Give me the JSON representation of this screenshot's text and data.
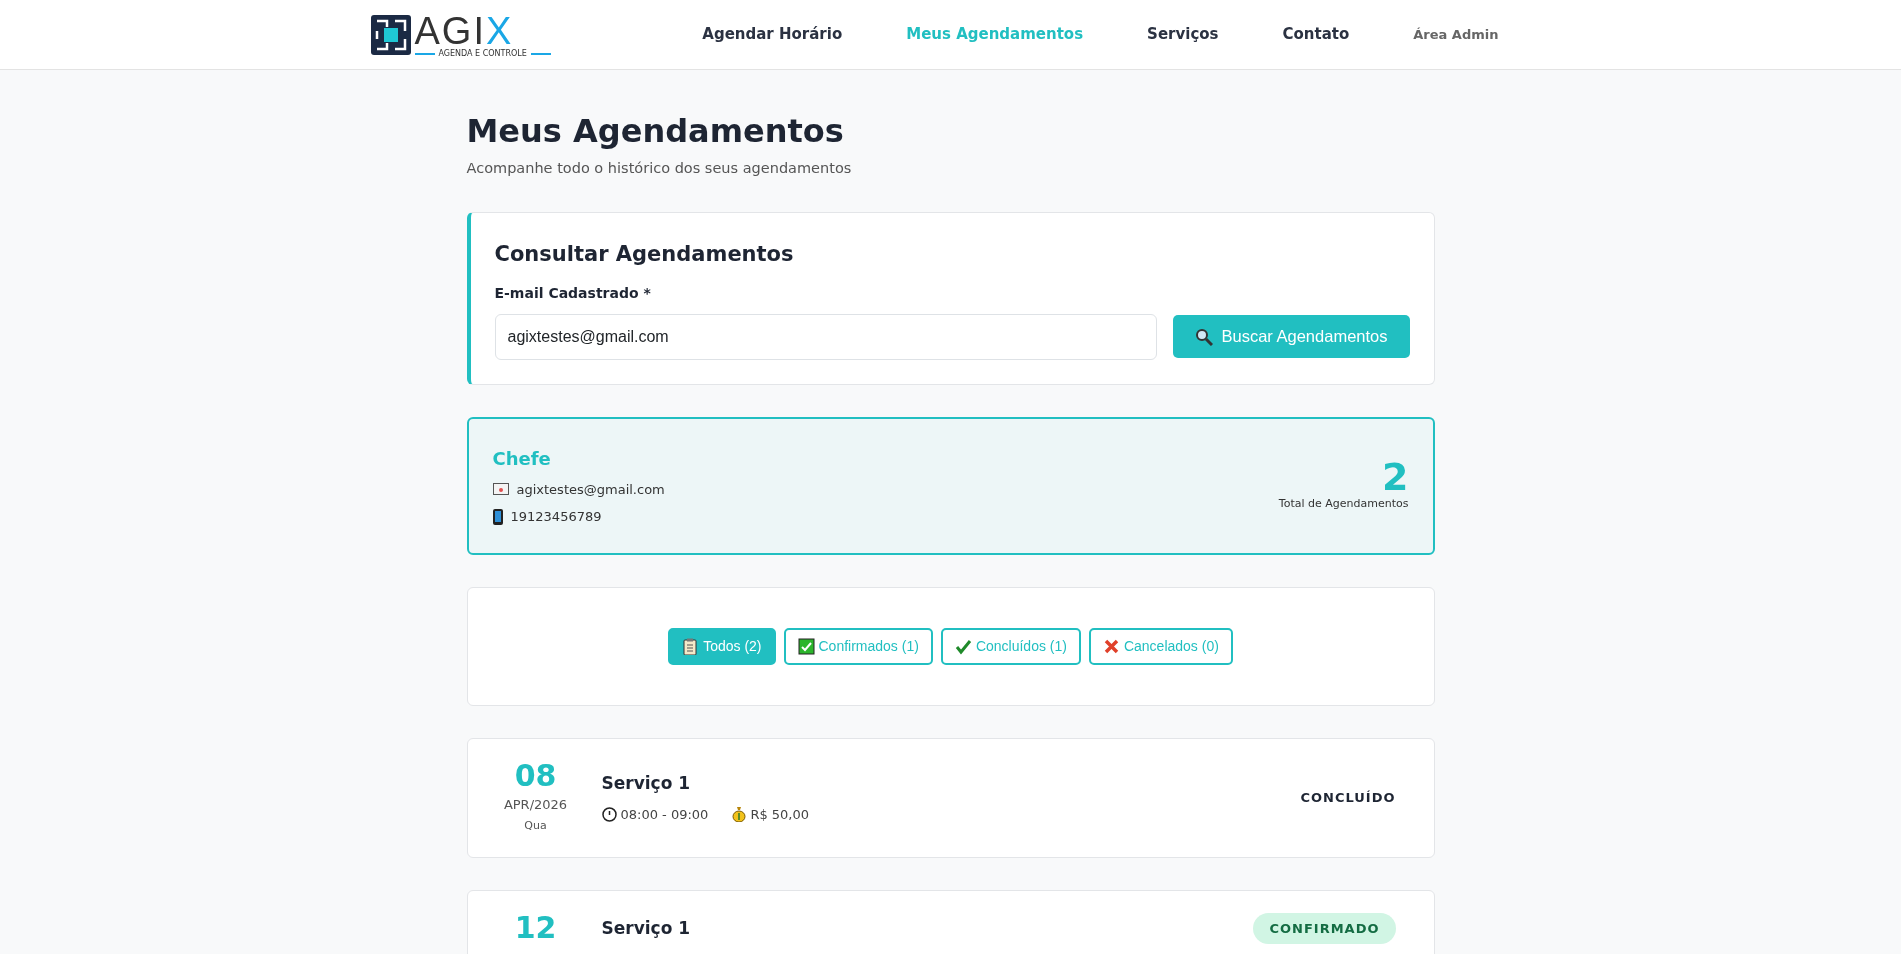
{
  "navbar": {
    "brand": {
      "name": "AGIX",
      "tagline": "AGENDA E CONTROLE"
    },
    "links": [
      {
        "label": "Agendar Horário",
        "selected": false,
        "kind": "main"
      },
      {
        "label": "Meus Agendamentos",
        "selected": true,
        "kind": "main"
      },
      {
        "label": "Serviços",
        "selected": false,
        "kind": "main"
      },
      {
        "label": "Contato",
        "selected": false,
        "kind": "main"
      },
      {
        "label": "Área Admin",
        "selected": false,
        "kind": "admin"
      }
    ]
  },
  "page": {
    "title": "Meus Agendamentos",
    "subtitle": "Acompanhe todo o histórico dos seus agendamentos"
  },
  "search": {
    "title": "Consultar Agendamentos",
    "label": "E-mail Cadastrado *",
    "value": "agixtestes@gmail.com",
    "button": "Buscar Agendamentos"
  },
  "client": {
    "name": "Chefe",
    "email": "agixtestes@gmail.com",
    "phone": "19123456789",
    "total": "2",
    "total_label": "Total de Agendamentos"
  },
  "filters": [
    {
      "label": "Todos (2)",
      "kind": "all",
      "selected": true
    },
    {
      "label": "Confirmados (1)",
      "kind": "confirmed",
      "selected": false
    },
    {
      "label": "Concluídos (1)",
      "kind": "completed",
      "selected": false
    },
    {
      "label": "Cancelados (0)",
      "kind": "cancelled",
      "selected": false
    }
  ],
  "appointments": [
    {
      "day": "08",
      "month": "APR/2026",
      "weekday": "Qua",
      "service": "Serviço 1",
      "time": "08:00 - 09:00",
      "price": "R$ 50,00",
      "status": "CONCLUÍDO",
      "kind": "completed"
    },
    {
      "day": "12",
      "service": "Serviço 1",
      "status": "CONFIRMADO",
      "kind": "confirmed"
    }
  ]
}
